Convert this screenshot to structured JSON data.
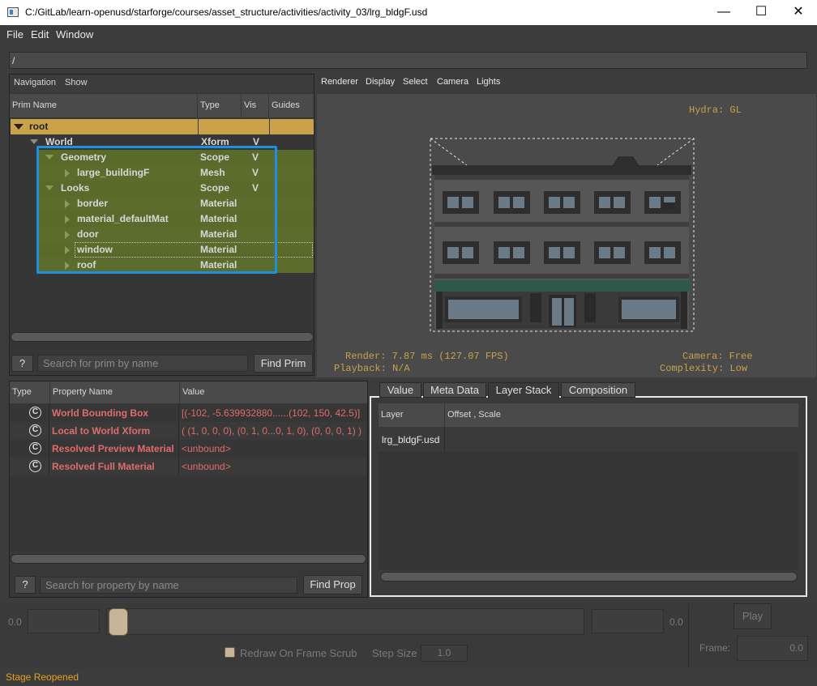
{
  "window": {
    "title": "C:/GitLab/learn-openusd/starforge/courses/asset_structure/activities/activity_03/lrg_bldgF.usd",
    "minimize": "—",
    "maximize": "☐",
    "close": "✕"
  },
  "menu": [
    "File",
    "Edit",
    "Window"
  ],
  "path": "/",
  "browser": {
    "toolbar": [
      "Navigation",
      "Show"
    ],
    "columns": [
      "Prim Name",
      "Type",
      "Vis",
      "Guides"
    ],
    "rows": [
      {
        "name": "root",
        "type": "",
        "vis": ""
      },
      {
        "name": "World",
        "type": "Xform",
        "vis": "V"
      },
      {
        "name": "Geometry",
        "type": "Scope",
        "vis": "V"
      },
      {
        "name": "large_buildingF",
        "type": "Mesh",
        "vis": "V"
      },
      {
        "name": "Looks",
        "type": "Scope",
        "vis": "V"
      },
      {
        "name": "border",
        "type": "Material",
        "vis": ""
      },
      {
        "name": "material_defaultMat",
        "type": "Material",
        "vis": ""
      },
      {
        "name": "door",
        "type": "Material",
        "vis": ""
      },
      {
        "name": "window",
        "type": "Material",
        "vis": ""
      },
      {
        "name": "roof",
        "type": "Material",
        "vis": ""
      }
    ],
    "help_label": "?",
    "search_placeholder": "Search for prim by name",
    "find_label": "Find Prim"
  },
  "viewport": {
    "menu": [
      "Renderer",
      "Display",
      "Select",
      "Camera",
      "Lights"
    ],
    "hydra": "Hydra: GL",
    "render_stats": "Render: 7.87 ms (127.07 FPS)",
    "playback": "Playback: N/A",
    "camera": "Camera: Free",
    "complexity": "Complexity: Low"
  },
  "properties": {
    "columns": [
      "Type",
      "Property Name",
      "Value"
    ],
    "icon": "C",
    "rows": [
      {
        "name": "World Bounding Box",
        "value": "[(-102, -5.639932880......(102, 150, 42.5)]"
      },
      {
        "name": "Local to World Xform",
        "value": "( (1, 0, 0, 0), (0, 1, 0...0, 1, 0), (0, 0, 0, 1) )"
      },
      {
        "name": "Resolved Preview Material",
        "value": "<unbound>"
      },
      {
        "name": "Resolved Full Material",
        "value": "<unbound>"
      }
    ],
    "help_label": "?",
    "search_placeholder": "Search for property by name",
    "find_label": "Find Prop"
  },
  "tabs": [
    "Value",
    "Meta Data",
    "Layer Stack",
    "Composition"
  ],
  "layer_stack": {
    "columns": [
      "Layer",
      "Offset , Scale"
    ],
    "rows": [
      {
        "layer": "lrg_bldgF.usd",
        "offset": ""
      }
    ]
  },
  "timeline": {
    "start_label": "0.0",
    "end_label": "0.0",
    "play_label": "Play",
    "redraw_label": "Redraw On Frame Scrub",
    "step_label": "Step Size",
    "step_value": "1.0",
    "frame_label": "Frame:",
    "frame_value": "0.0"
  },
  "status": "Stage Reopened",
  "colors": {
    "selection": "#c9a24a",
    "highlight_box": "#1e90e0",
    "property_text": "#e06c6c",
    "row_green": "#5a6a2a"
  }
}
